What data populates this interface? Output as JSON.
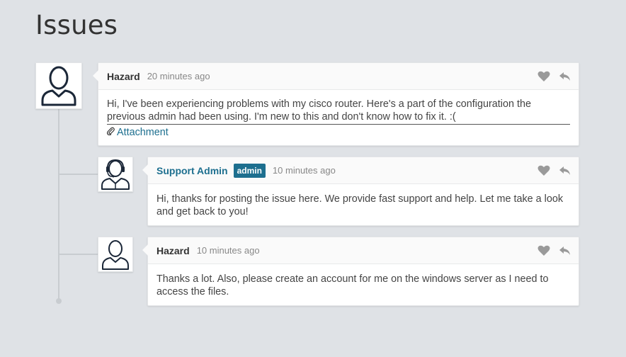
{
  "page": {
    "title": "Issues"
  },
  "comments": [
    {
      "author": "Hazard",
      "time": "20 minutes ago",
      "text": "Hi, I've been experiencing problems with my cisco router. Here's a part of the configuration the previous admin had been using. I'm new to this and don't know how to fix it. :(",
      "attachment_label": "Attachment"
    },
    {
      "author": "Support Admin",
      "badge": "admin",
      "time": "10 minutes ago",
      "text": "Hi, thanks for posting the issue here. We provide fast support and help. Let me take a look and get back to you!"
    },
    {
      "author": "Hazard",
      "time": "10 minutes ago",
      "text": "Thanks a lot. Also, please create an account for me on the windows server as I need to access the files."
    }
  ],
  "icons": {
    "like": "heart-icon",
    "reply": "reply-icon",
    "attachment": "paperclip-icon"
  },
  "colors": {
    "accent": "#1d6f8f",
    "background": "#dfe2e6",
    "icon": "#9a9a9a"
  }
}
